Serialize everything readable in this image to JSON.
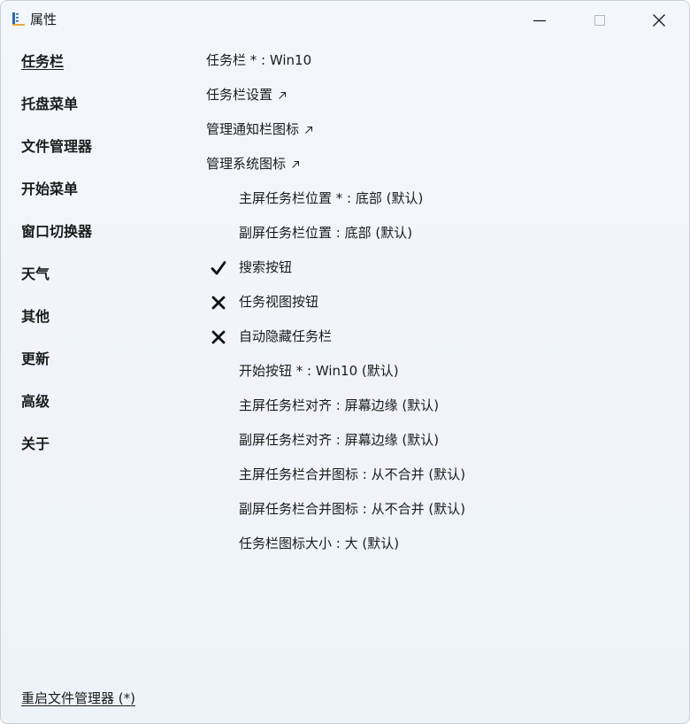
{
  "window": {
    "title": "属性"
  },
  "nav": {
    "items": [
      {
        "label": "任务栏",
        "active": true
      },
      {
        "label": "托盘菜单"
      },
      {
        "label": "文件管理器"
      },
      {
        "label": "开始菜单"
      },
      {
        "label": "窗口切换器"
      },
      {
        "label": "天气"
      },
      {
        "label": "其他"
      },
      {
        "label": "更新"
      },
      {
        "label": "高级"
      },
      {
        "label": "关于"
      }
    ]
  },
  "content": {
    "taskbar_style": "任务栏 * : Win10",
    "taskbar_settings": "任务栏设置",
    "manage_tray_icons": "管理通知栏图标",
    "manage_system_icons": "管理系统图标",
    "primary_position": "主屏任务栏位置 * : 底部 (默认)",
    "secondary_position": "副屏任务栏位置 : 底部 (默认)",
    "search_button": "搜索按钮",
    "task_view_button": "任务视图按钮",
    "auto_hide": "自动隐藏任务栏",
    "start_button": "开始按钮 * : Win10 (默认)",
    "primary_align": "主屏任务栏对齐 : 屏幕边缘 (默认)",
    "secondary_align": "副屏任务栏对齐 : 屏幕边缘 (默认)",
    "primary_combine": "主屏任务栏合并图标 : 从不合并 (默认)",
    "secondary_combine": "副屏任务栏合并图标 : 从不合并 (默认)",
    "icon_size": "任务栏图标大小 : 大 (默认)"
  },
  "toggles": {
    "search_button": "on",
    "task_view_button": "off",
    "auto_hide": "off"
  },
  "footer": {
    "restart_label": "重启文件管理器 (*)"
  }
}
